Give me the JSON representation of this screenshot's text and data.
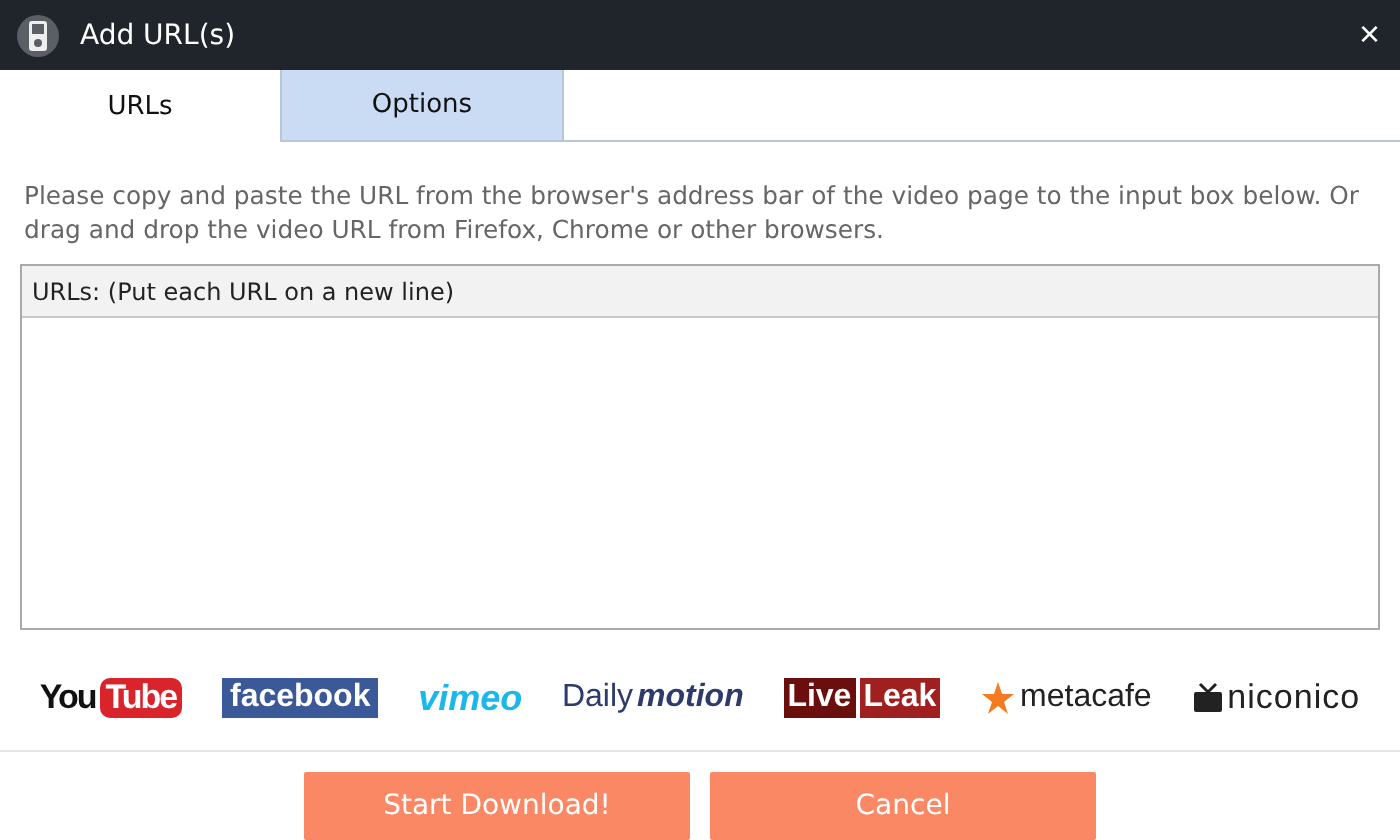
{
  "window": {
    "title": "Add URL(s)",
    "close": "×"
  },
  "tabs": [
    {
      "label": "URLs",
      "selected": true
    },
    {
      "label": "Options",
      "selected": false
    }
  ],
  "instructions": "Please copy and paste the URL from the browser's address bar of the video page to the input box below. Or drag and drop the video URL from Firefox, Chrome or other browsers.",
  "urls_box": {
    "header": "URLs: (Put each URL on a new line)"
  },
  "sites": [
    {
      "kind": "youtube",
      "parts": [
        "You",
        "Tube"
      ]
    },
    {
      "kind": "facebook",
      "parts": [
        "facebook"
      ]
    },
    {
      "kind": "vimeo",
      "parts": [
        "vimeo"
      ]
    },
    {
      "kind": "dailymotion",
      "parts": [
        "Daily",
        "motion"
      ]
    },
    {
      "kind": "liveleak",
      "parts": [
        "Live",
        "Leak"
      ]
    },
    {
      "kind": "metacafe",
      "parts": [
        "metacafe"
      ]
    },
    {
      "kind": "niconico",
      "parts": [
        "niconico"
      ]
    }
  ],
  "buttons": [
    "Start Download!",
    "Cancel"
  ]
}
